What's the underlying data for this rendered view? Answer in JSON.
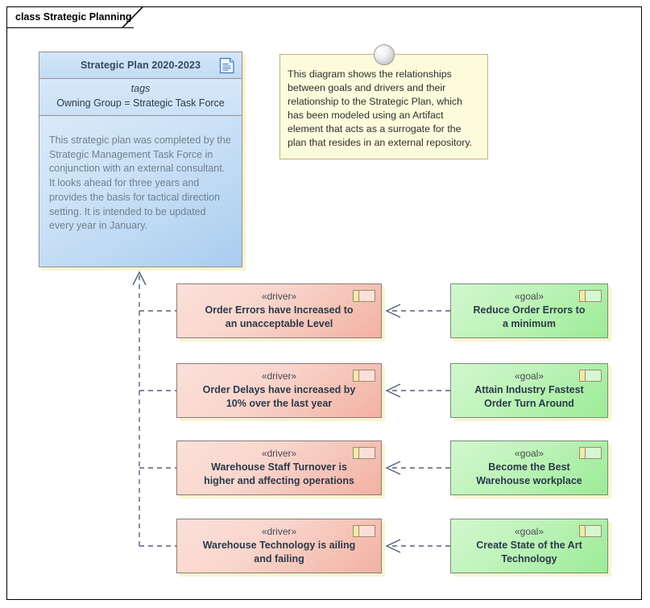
{
  "diagram": {
    "frame_label": "class Strategic Planning",
    "type": "UML class diagram"
  },
  "artifact": {
    "name": "Strategic Plan 2020-2023",
    "icon": "artifact-document-icon",
    "tags_label": "tags",
    "tags_value": "Owning Group = Strategic Task Force",
    "notes": "This strategic plan was completed by the Strategic Management Task Force in conjunction with an external consultant. It looks ahead for three years and provides the basis for tactical direction setting. It is intended to be updated every year in January."
  },
  "note": {
    "text": "This diagram shows the relationships between goals and drivers and their relationship to the Strategic Plan, which has been modeled using an Artifact element that acts as a surrogate for the plan that resides in an external repository.",
    "pin_icon": "note-anchor-circle-icon"
  },
  "drivers": [
    {
      "stereotype": "«driver»",
      "name_line1": "Order Errors have Increased to",
      "name_line2": "an unacceptable Level",
      "icon": "motivation-driver-icon"
    },
    {
      "stereotype": "«driver»",
      "name_line1": "Order Delays have increased by",
      "name_line2": "10% over the last year",
      "icon": "motivation-driver-icon"
    },
    {
      "stereotype": "«driver»",
      "name_line1": "Warehouse Staff Turnover is",
      "name_line2": "higher and affecting operations",
      "icon": "motivation-driver-icon"
    },
    {
      "stereotype": "«driver»",
      "name_line1": "Warehouse Technology is ailing",
      "name_line2": "and failing",
      "icon": "motivation-driver-icon"
    }
  ],
  "goals": [
    {
      "stereotype": "«goal»",
      "name_line1": "Reduce Order Errors to",
      "name_line2": "a minimum",
      "icon": "motivation-goal-icon"
    },
    {
      "stereotype": "«goal»",
      "name_line1": "Attain Industry Fastest",
      "name_line2": "Order Turn Around",
      "icon": "motivation-goal-icon"
    },
    {
      "stereotype": "«goal»",
      "name_line1": "Become the Best",
      "name_line2": "Warehouse workplace",
      "icon": "motivation-goal-icon"
    },
    {
      "stereotype": "«goal»",
      "name_line1": "Create State of the Art",
      "name_line2": "Technology",
      "icon": "motivation-goal-icon"
    }
  ],
  "colors": {
    "driver_fill": "#f6cdc2",
    "goal_fill": "#b6f2b0",
    "artifact_fill": "#c6dff5",
    "note_fill": "#fcfbdc",
    "connector": "#55617a",
    "frame_border": "#000000"
  }
}
